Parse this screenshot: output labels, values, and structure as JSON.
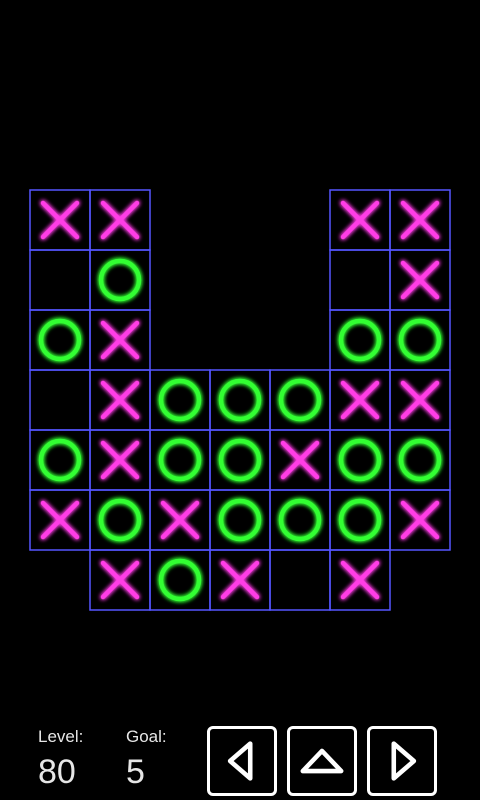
{
  "board": {
    "rows": [
      [
        "X",
        "X",
        "#",
        "#",
        "#",
        "X",
        "X"
      ],
      [
        ".",
        "O",
        "#",
        "#",
        "#",
        ".",
        "X"
      ],
      [
        "O",
        "X",
        "#",
        "#",
        "#",
        "O",
        "O"
      ],
      [
        ".",
        "X",
        "O",
        "O",
        "O",
        "X",
        "X"
      ],
      [
        "O",
        "X",
        "O",
        "O",
        "X",
        "O",
        "O"
      ],
      [
        "X",
        "O",
        "X",
        "O",
        "O",
        "O",
        "X"
      ],
      [
        "#",
        "X",
        "O",
        "X",
        ".",
        "X",
        "#"
      ]
    ],
    "colors": {
      "x": "#ff3de6",
      "o": "#33ff33",
      "grid": "#5555ff"
    }
  },
  "status": {
    "level_label": "Level:",
    "level_value": "80",
    "goal_label": "Goal:",
    "goal_value": "5"
  },
  "controls": {
    "left_icon": "triangle-left-icon",
    "up_icon": "triangle-up-icon",
    "right_icon": "triangle-right-icon"
  }
}
